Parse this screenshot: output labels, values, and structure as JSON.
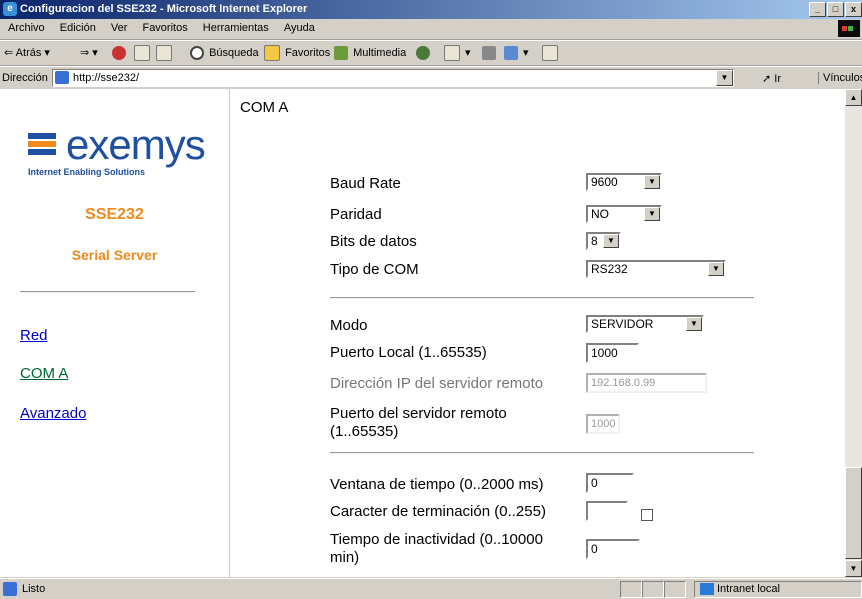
{
  "window": {
    "title": "Configuracion del SSE232 - Microsoft Internet Explorer",
    "minimize": "_",
    "maximize": "□",
    "close": "x"
  },
  "menu": [
    "Archivo",
    "Edición",
    "Ver",
    "Favoritos",
    "Herramientas",
    "Ayuda"
  ],
  "toolbar": {
    "back": "Atrás",
    "back_icon": "⇐",
    "forward_icon": "⇒",
    "search": "Búsqueda",
    "favorites": "Favoritos",
    "multimedia": "Multimedia"
  },
  "address": {
    "label": "Dirección",
    "url": "http://sse232/",
    "go": "Ir",
    "links": "Vínculos"
  },
  "sidebar": {
    "logo_text": "exemys",
    "logo_tagline": "Internet Enabling Solutions",
    "product": "SSE232",
    "subtitle": "Serial Server",
    "nav": [
      "Red",
      "COM A",
      "Avanzado"
    ]
  },
  "form": {
    "title": "COM A",
    "baud_rate": {
      "label": "Baud Rate",
      "value": "9600"
    },
    "paridad": {
      "label": "Paridad",
      "value": "NO"
    },
    "bits_datos": {
      "label": "Bits de datos",
      "value": "8"
    },
    "tipo_com": {
      "label": "Tipo de COM",
      "value": "RS232"
    },
    "modo": {
      "label": "Modo",
      "value": "SERVIDOR"
    },
    "puerto_local": {
      "label": "Puerto Local (1..65535)",
      "value": "1000"
    },
    "ip_remoto": {
      "label": "Dirección IP del servidor remoto",
      "value": "192.168.0.99"
    },
    "puerto_remoto": {
      "label_1": "Puerto del servidor remoto",
      "label_2": "(1..65535)",
      "value": "1000"
    },
    "ventana": {
      "label": "Ventana de tiempo (0..2000 ms)",
      "value": "0"
    },
    "caracter": {
      "label": "Caracter de terminación (0..255)",
      "value": "",
      "checked": false
    },
    "inactividad": {
      "label_1": "Tiempo de inactividad (0..10000",
      "label_2": "min)",
      "value": "0"
    }
  },
  "status": {
    "text": "Listo",
    "zone": "Intranet local"
  },
  "colors": {
    "accent_orange": "#f08a1c",
    "brand_blue": "#1e4fa0",
    "link_blue": "#0000cc",
    "link_visited": "#006633"
  }
}
